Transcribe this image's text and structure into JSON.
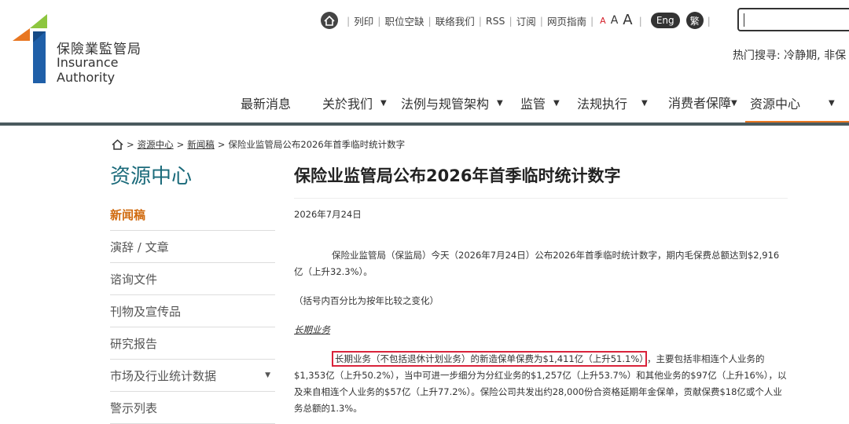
{
  "header": {
    "logo_cn": "保險業監管局",
    "logo_en": "Insurance Authority",
    "utility_links": [
      "列印",
      "职位空缺",
      "联络我们",
      "RSS",
      "订阅",
      "网页指南"
    ],
    "font_sizes": [
      "A",
      "A",
      "A"
    ],
    "lang_label": "Eng",
    "trad_label": "繁",
    "hot_search": "热门搜寻: 冷静期, 非保",
    "nav": [
      {
        "label": "最新消息",
        "dropdown": false
      },
      {
        "label": "关於我们",
        "dropdown": true
      },
      {
        "label": "法例与规管架构",
        "dropdown": true
      },
      {
        "label": "监管",
        "dropdown": true
      },
      {
        "label": "法规执行",
        "dropdown": true
      },
      {
        "label": "消费者保障",
        "dropdown": true
      },
      {
        "label": "资源中心",
        "dropdown": true
      }
    ]
  },
  "breadcrumb": {
    "items": [
      "资源中心",
      "新闻稿"
    ],
    "current": "保险业监管局公布2026年首季临时统计数字"
  },
  "sidebar": {
    "title": "资源中心",
    "items": [
      {
        "label": "新闻稿",
        "active": true
      },
      {
        "label": "演辞 / 文章"
      },
      {
        "label": "谘询文件"
      },
      {
        "label": "刊物及宣传品"
      },
      {
        "label": "研究报告"
      },
      {
        "label": "市场及行业统计数据",
        "dropdown": true
      },
      {
        "label": "警示列表"
      }
    ]
  },
  "article": {
    "title": "保险业监管局公布2026年首季临时统计数字",
    "date": "2026年7月24日",
    "p1": "保险业监管局（保监局）今天（2026年7月24日）公布2026年首季临时统计数字，期内毛保费总额达到$2,916亿（上升32.3%）。",
    "p2": "（括号内百分比为按年比较之变化）",
    "p3": "长期业务",
    "p4_highlight": "长期业务（不包括退休计划业务）的新造保单保费为$1,411亿（上升51.1%）",
    "p4_rest": "，主要包括非相连个人业务的$1,353亿（上升50.2%），当中可进一步细分为分红业务的$1,257亿（上升53.7%）和其他业务的$97亿（上升16%），以及来自相连个人业务的$57亿（上升77.2%）。保险公司共发出约28,000份合资格延期年金保单，贡献保费$18亿或个人业务总额的1.3%。"
  },
  "colors": {
    "accent_orange": "#e87722",
    "highlight_red": "#d9233b",
    "title_teal": "#1a6a7a"
  }
}
